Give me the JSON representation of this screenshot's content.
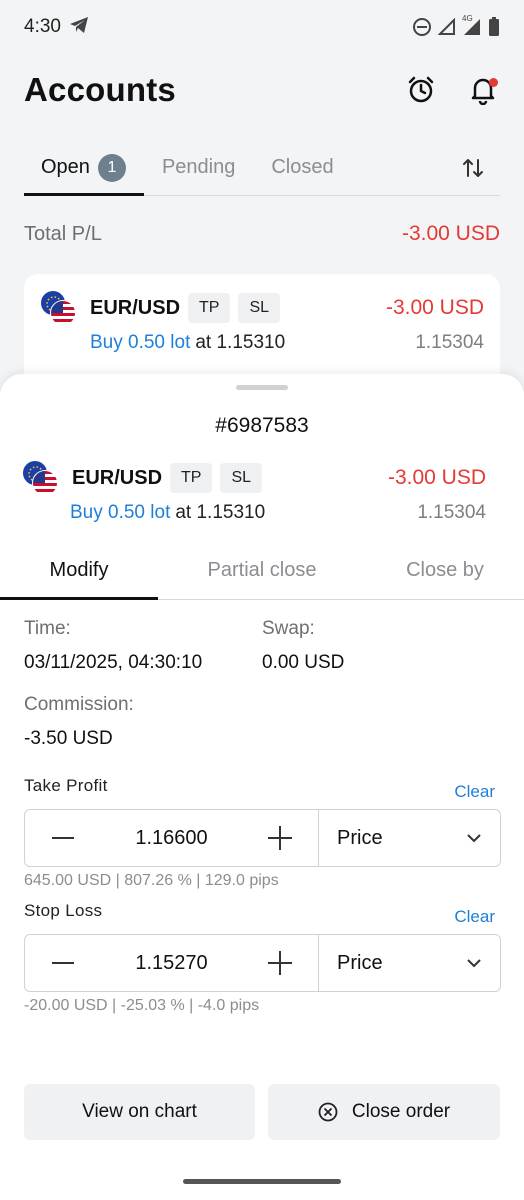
{
  "status_bar": {
    "time": "4:30",
    "network_label": "4G"
  },
  "header": {
    "title": "Accounts"
  },
  "tabs": [
    {
      "label": "Open",
      "badge": "1"
    },
    {
      "label": "Pending"
    },
    {
      "label": "Closed"
    }
  ],
  "total": {
    "label": "Total P/L",
    "value": "-3.00 USD"
  },
  "position": {
    "symbol": "EUR/USD",
    "tags": [
      "TP",
      "SL"
    ],
    "pl": "-3.00 USD",
    "direction": "Buy 0.50 lot",
    "open_price_text": "at 1.15310",
    "current_price": "1.15304"
  },
  "sheet": {
    "order_id": "#6987583",
    "tabs": [
      "Modify",
      "Partial close",
      "Close by"
    ],
    "time_label": "Time:",
    "time_value": "03/11/2025, 04:30:10",
    "swap_label": "Swap:",
    "swap_value": "0.00 USD",
    "commission_label": "Commission:",
    "commission_value": "-3.50 USD",
    "take_profit": {
      "title": "Take Profit",
      "clear": "Clear",
      "value": "1.16600",
      "mode": "Price",
      "hint": "645.00 USD | 807.26 % | 129.0 pips"
    },
    "stop_loss": {
      "title": "Stop Loss",
      "clear": "Clear",
      "value": "1.15270",
      "mode": "Price",
      "hint": "-20.00 USD | -25.03 % | -4.0 pips"
    },
    "view_chart_label": "View on chart",
    "close_order_label": "Close order"
  },
  "colors": {
    "loss": "#e53935",
    "link": "#1e7fd8",
    "badge": "#6e7f8f"
  }
}
